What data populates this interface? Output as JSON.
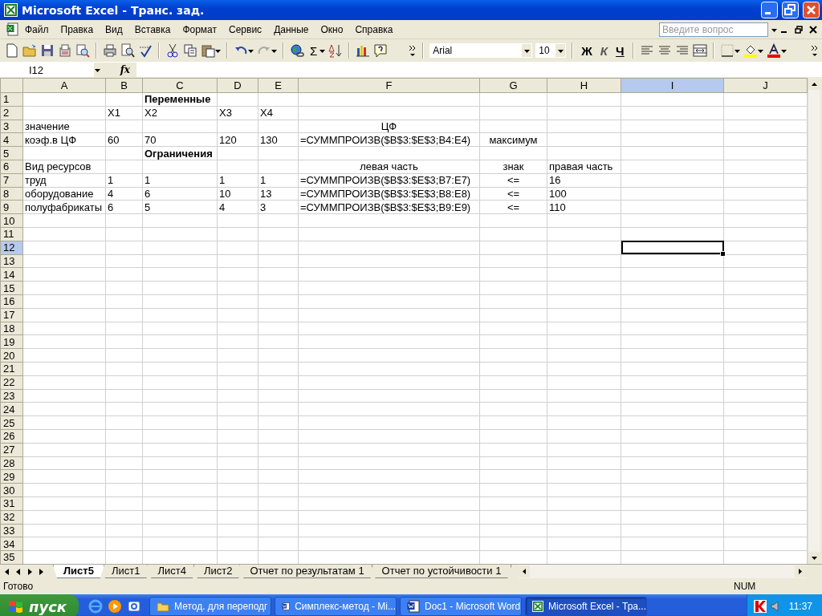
{
  "window": {
    "title": "Microsoft Excel - Транс. зад."
  },
  "menu": [
    {
      "label": "Файл"
    },
    {
      "label": "Правка"
    },
    {
      "label": "Вид"
    },
    {
      "label": "Вставка"
    },
    {
      "label": "Формат"
    },
    {
      "label": "Сервис"
    },
    {
      "label": "Данные"
    },
    {
      "label": "Окно"
    },
    {
      "label": "Справка"
    }
  ],
  "help_box": {
    "placeholder": "Введите вопрос"
  },
  "toolbar": {
    "autosum": "Σ",
    "font": "Arial",
    "font_size": "10",
    "bold": "Ж",
    "italic": "К",
    "underline": "Ч"
  },
  "formula_bar": {
    "name_box": "I12",
    "fx": "fx"
  },
  "columns": [
    {
      "label": "A",
      "selected": false
    },
    {
      "label": "B",
      "selected": false
    },
    {
      "label": "C",
      "selected": false
    },
    {
      "label": "D",
      "selected": false
    },
    {
      "label": "E",
      "selected": false
    },
    {
      "label": "F",
      "selected": false
    },
    {
      "label": "G",
      "selected": false
    },
    {
      "label": "H",
      "selected": false
    },
    {
      "label": "I",
      "selected": true
    },
    {
      "label": "J",
      "selected": false
    }
  ],
  "rows": [
    {
      "number": "1",
      "selected": false,
      "cells": [
        null,
        null,
        {
          "text": "Переменные",
          "kind": "heading"
        }
      ]
    },
    {
      "number": "2",
      "selected": false,
      "cells": [
        null,
        "X1",
        "X2",
        "X3",
        "X4"
      ]
    },
    {
      "number": "3",
      "selected": false,
      "cells": [
        "значение",
        null,
        null,
        null,
        null,
        {
          "text": "ЦФ",
          "kind": "centered"
        }
      ]
    },
    {
      "number": "4",
      "selected": false,
      "cells": [
        "коэф.в ЦФ",
        "60",
        "70",
        "120",
        "130",
        "=СУММПРОИЗВ($B$3:$E$3;B4:E4)",
        {
          "text": "максимум",
          "kind": "centered"
        }
      ]
    },
    {
      "number": "5",
      "selected": false,
      "cells": [
        null,
        null,
        {
          "text": "Ограничения",
          "kind": "heading"
        }
      ]
    },
    {
      "number": "6",
      "selected": false,
      "cells": [
        "Вид ресурсов",
        null,
        null,
        null,
        null,
        {
          "text": "левая часть",
          "kind": "centered"
        },
        {
          "text": "знак",
          "kind": "centered"
        },
        "правая часть"
      ]
    },
    {
      "number": "7",
      "selected": false,
      "cells": [
        "труд",
        "1",
        "1",
        "1",
        "1",
        "=СУММПРОИЗВ($B$3:$E$3;B7:E7)",
        {
          "text": "<=",
          "kind": "centered"
        },
        "16"
      ]
    },
    {
      "number": "8",
      "selected": false,
      "cells": [
        "оборудование",
        "4",
        "6",
        "10",
        "13",
        "=СУММПРОИЗВ($B$3:$E$3;B8:E8)",
        {
          "text": "<=",
          "kind": "centered"
        },
        "100"
      ]
    },
    {
      "number": "9",
      "selected": false,
      "cells": [
        "полуфабрикаты",
        "6",
        "5",
        "4",
        "3",
        "=СУММПРОИЗВ($B$3:$E$3;B9:E9)",
        {
          "text": "<=",
          "kind": "centered"
        },
        "110"
      ]
    },
    {
      "number": "10",
      "selected": false
    },
    {
      "number": "11",
      "selected": false
    },
    {
      "number": "12",
      "selected": true
    },
    {
      "number": "13",
      "selected": false
    },
    {
      "number": "14",
      "selected": false
    },
    {
      "number": "15",
      "selected": false
    },
    {
      "number": "16",
      "selected": false
    },
    {
      "number": "17",
      "selected": false
    },
    {
      "number": "18",
      "selected": false
    },
    {
      "number": "19",
      "selected": false
    },
    {
      "number": "20",
      "selected": false
    },
    {
      "number": "21",
      "selected": false
    },
    {
      "number": "22",
      "selected": false
    },
    {
      "number": "23",
      "selected": false
    },
    {
      "number": "24",
      "selected": false
    },
    {
      "number": "25",
      "selected": false
    },
    {
      "number": "26",
      "selected": false
    },
    {
      "number": "27",
      "selected": false
    },
    {
      "number": "28",
      "selected": false
    },
    {
      "number": "29",
      "selected": false
    },
    {
      "number": "30",
      "selected": false
    },
    {
      "number": "31",
      "selected": false
    },
    {
      "number": "32",
      "selected": false
    },
    {
      "number": "33",
      "selected": false
    },
    {
      "number": "34",
      "selected": false
    },
    {
      "number": "35",
      "selected": false
    }
  ],
  "sheet_tabs": [
    {
      "label": "Лист5",
      "selected": true
    },
    {
      "label": "Лист1",
      "selected": false
    },
    {
      "label": "Лист4",
      "selected": false
    },
    {
      "label": "Лист2",
      "selected": false
    },
    {
      "label": "Отчет по результатам 1",
      "selected": false
    },
    {
      "label": "Отчет по устойчивости 1",
      "selected": false
    }
  ],
  "status_bar": {
    "text": "Готово",
    "indicator": "NUM"
  },
  "taskbar": {
    "start": "пуск",
    "tasks": [
      {
        "label": "Метод. для переподг",
        "kind": "folder",
        "selected": false
      },
      {
        "label": "Симплекс-метод - Mi...",
        "kind": "word",
        "selected": false
      },
      {
        "label": "Doc1 - Microsoft Word",
        "kind": "word",
        "selected": false
      },
      {
        "label": "Microsoft Excel - Тра...",
        "kind": "excel",
        "selected": true
      }
    ],
    "clock": "11:37"
  }
}
